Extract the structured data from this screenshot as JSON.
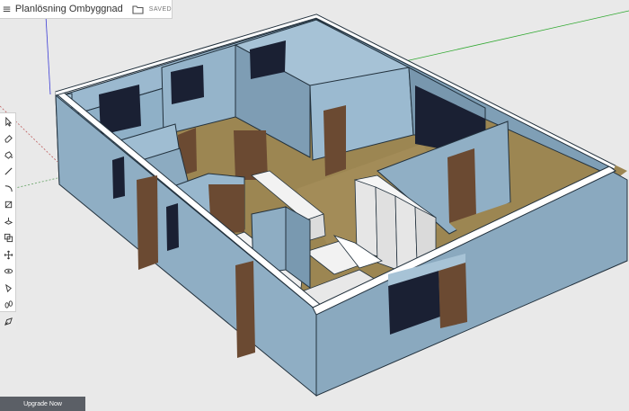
{
  "app": {
    "document_title": "Planlösning Ombyggnad",
    "save_status": "SAVED"
  },
  "toolbar": {
    "tools": [
      {
        "name": "select-tool-icon"
      },
      {
        "name": "eraser-tool-icon"
      },
      {
        "name": "paint-bucket-tool-icon"
      },
      {
        "name": "line-tool-icon"
      },
      {
        "name": "arc-tool-icon"
      },
      {
        "name": "rectangle-tool-icon"
      },
      {
        "name": "push-pull-tool-icon"
      },
      {
        "name": "offset-tool-icon"
      },
      {
        "name": "move-tool-icon"
      },
      {
        "name": "orbit-tool-icon"
      },
      {
        "name": "tape-measure-tool-icon"
      },
      {
        "name": "walk-tool-icon"
      },
      {
        "name": "section-plane-tool-icon"
      }
    ]
  },
  "footer": {
    "upgrade_label": "Upgrade Now"
  },
  "colors": {
    "wall": "#8faec4",
    "wall_top": "#ffffff",
    "floor": "#9c8652",
    "door": "#6b4a32",
    "window": "#1a2033",
    "cabinet": "#f2f2f2",
    "background": "#e9e9e9"
  }
}
